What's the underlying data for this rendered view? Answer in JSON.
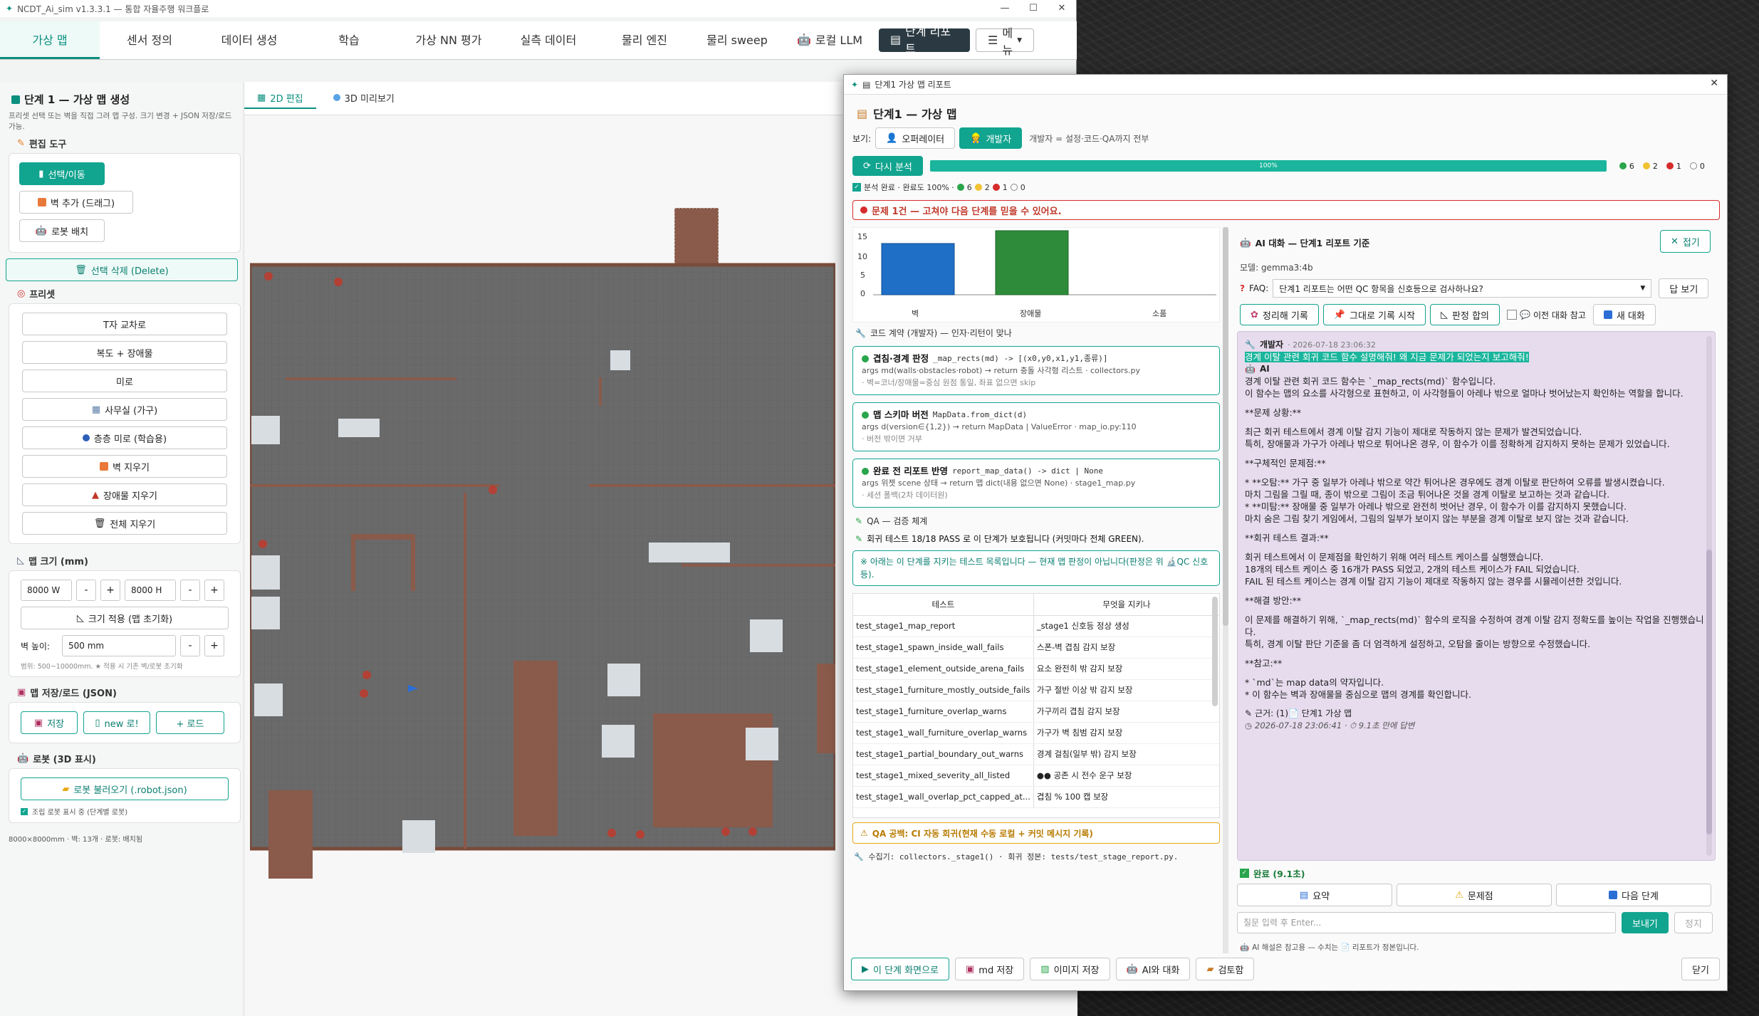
{
  "window": {
    "title": "NCDT_Ai_sim v1.3.3.1 — 통합 자율주행 워크플로"
  },
  "tabs": [
    {
      "label": "가상 맵"
    },
    {
      "label": "센서 정의"
    },
    {
      "label": "데이터 생성"
    },
    {
      "label": "학습"
    },
    {
      "label": "가상 NN 평가"
    },
    {
      "label": "실측 데이터"
    },
    {
      "label": "물리 엔진"
    },
    {
      "label": "물리 sweep"
    },
    {
      "label": "로컬 LLM"
    },
    {
      "label": "단계 리포트"
    },
    {
      "label": "메뉴"
    }
  ],
  "sidebar": {
    "title": "단계 1 — 가상 맵 생성",
    "desc": "프리셋 선택 또는 벽을 직접 그려 맵 구성. 크기 변경 + JSON 저장/로드 가능.",
    "edit_tools": "편집 도구",
    "select_move": "선택/이동",
    "add_wall": "벽 추가 (드래그)",
    "place_robot": "로봇 배치",
    "delete_sel": "선택 삭제 (Delete)",
    "presets_title": "프리셋",
    "presets": [
      "T자 교차로",
      "복도 + 장애물",
      "미로",
      "사무실 (가구)",
      "층층 미로 (학습용)",
      "벽 지우기",
      "장애물 지우기",
      "전체 지우기"
    ],
    "mapsize_title": "맵 크기 (mm)",
    "width": "8000 W",
    "height": "8000 H",
    "apply_size": "크기 적용 (맵 초기화)",
    "wall_height_label": "벽 높이:",
    "wall_height": "500 mm",
    "range_note": "범위: 500~10000mm. ★ 적용 시 기존 벽/로봇 초기화",
    "saveload_title": "맵 저장/로드 (JSON)",
    "save": "저장",
    "new": "new 로!",
    "load": "+ 로드",
    "robot_title": "로봇 (3D 표시)",
    "robot_load": "로봇 불러오기 (.robot.json)",
    "robot_check": "조립 로봇 표시 중 (단계별 로봇)",
    "status": "8000×8000mm · 벽: 13개 · 로봇: 배치됨"
  },
  "editor": {
    "tab2d": "2D 편집",
    "tab3d": "3D 미리보기"
  },
  "report": {
    "win_title": "단계1 가상 맵 리포트",
    "heading": "단계1 — 가상 맵",
    "view_label": "보기:",
    "operator": "오퍼레이터",
    "developer": "개발자",
    "dev_note": "개발자 = 설정·코드·QA까지 전부",
    "reanalyze": "다시 분석",
    "progress_label": "100%",
    "counts": {
      "green": "6",
      "yellow": "2",
      "red": "1",
      "none": "0"
    },
    "analysis_done": "분석 완료 · 완료도 100% ·",
    "issue_banner": "문제 1건 — 고쳐야 다음 단계를 믿을 수 있어요.",
    "contract_title": "코드 계약 (개발자) — 인자·리턴이 맞나",
    "contracts": [
      {
        "name": "겹침·경계 판정",
        "sig": "_map_rects(md) -> [(x0,y0,x1,y1,종류)]",
        "args": "args md(walls·obstacles·robot) → return 충돌 사각형 리스트 · collectors.py",
        "note": "· 벽=코너/장애물=중심 원점 통일, 좌표 없으면 skip"
      },
      {
        "name": "맵 스키마 버전",
        "sig": "MapData.from_dict(d)",
        "args": "args d(version∈{1,2}) → return MapData | ValueError · map_io.py:110",
        "note": "· 버전 밖이면 거부"
      },
      {
        "name": "완료 전 리포트 반영",
        "sig": "report_map_data() -> dict | None",
        "args": "args 위젯 scene 상태 → return 맵 dict(내용 없으면 None) · stage1_map.py",
        "note": "· 세션 폴백(2차 데이터원)"
      }
    ],
    "qa_title": "QA — 검증 체계",
    "qa_pass": "회귀 테스트 18/18 PASS 로 이 단계가 보호됩니다 (커밋마다 전체 GREEN).",
    "qa_note": "※ 아래는 이 단계를 지키는 테스트 목록입니다 — 현재 맵 판정이 아닙니다(판정은 위 🔬QC 신호등).",
    "qa_head": [
      "테스트",
      "무엇을 지키나"
    ],
    "qa_rows": [
      [
        "test_stage1_map_report",
        "_stage1 신호등 정상 생성"
      ],
      [
        "test_stage1_spawn_inside_wall_fails",
        "스폰-벽 겹침 감지 보장"
      ],
      [
        "test_stage1_element_outside_arena_fails",
        "요소 완전히 밖 감지 보장"
      ],
      [
        "test_stage1_furniture_mostly_outside_fails",
        "가구 절반 이상 밖 감지 보장"
      ],
      [
        "test_stage1_furniture_overlap_warns",
        "가구끼리 겹침 감지 보장"
      ],
      [
        "test_stage1_wall_furniture_overlap_warns",
        "가구가 벽 침범 감지 보장"
      ],
      [
        "test_stage1_partial_boundary_out_warns",
        "경계 걸침(일부 밖) 감지 보장"
      ],
      [
        "test_stage1_mixed_severity_all_listed",
        "●● 공존 시 전수 운구 보장"
      ],
      [
        "test_stage1_wall_overlap_pct_capped_at...",
        "겹침 % 100 캡 보장"
      ]
    ],
    "qa_gap": "QA 공백: CI 자동 회귀(현재 수동 로컬 + 커밋 메시지 기록)",
    "collector": "수집기: collectors._stage1() · 회귀 정본: tests/test_stage_report.py.",
    "chart": {
      "yticks": [
        "15",
        "10",
        "5",
        "0"
      ],
      "labels": [
        "벽",
        "장애물",
        "소품"
      ]
    },
    "ai_title": "AI 대화 — 단계1 리포트 기준",
    "collapse": "접기",
    "model": "모델: gemma3:4b",
    "faq_label": "FAQ:",
    "faq_value": "단계1 리포트는 어떤 QC 항목을 신호등으로 검사하나요?",
    "faq_btn": "답 보기",
    "chat_btns": [
      "정리해 기록",
      "그대로 기록 시작",
      "판정 합의"
    ],
    "prev_ref": "이전 대화 참고",
    "new_chat": "새 대화",
    "chat": {
      "user": "개발자",
      "time": "· 2026-07-18 23:06:32",
      "question": "경계 이탈 관련 회귀 코드 함수 설명해줘! 왜 지금 문제가 되었는지 보고해줘!",
      "ai": "AI",
      "lines": [
        "경계 이탈 관련 회귀 코드 함수는 `_map_rects(md)` 함수입니다.",
        "이 함수는 맵의 요소를 사각형으로 표현하고, 이 사각형들이 아레나 밖으로 얼마나 벗어났는지 확인하는 역할을 합니다.",
        "",
        "**문제 상황:**",
        "",
        "최근 회귀 테스트에서 경계 이탈 감지 기능이 제대로 작동하지 않는 문제가 발견되었습니다.",
        "특히, 장애물과 가구가 아레나 밖으로 튀어나온 경우, 이 함수가 이를 정확하게 감지하지 못하는 문제가 있었습니다.",
        "",
        "**구체적인 문제점:**",
        "",
        "* **오탐:** 가구 중 일부가 아레나 밖으로 약간 튀어나온 경우에도 경계 이탈로 판단하여 오류를 발생시켰습니다.",
        "마치 그림을 그릴 때, 종이 밖으로 그림이 조금 튀어나온 것을 경계 이탈로 보고하는 것과 같습니다.",
        "* **미탐:** 장애물 중 일부가 아레나 밖으로 완전히 벗어난 경우, 이 함수가 이를 감지하지 못했습니다.",
        "마치 숨은 그림 찾기 게임에서, 그림의 일부가 보이지 않는 부분을 경계 이탈로 보지 않는 것과 같습니다.",
        "",
        "**회귀 테스트 결과:**",
        "",
        "회귀 테스트에서 이 문제점을 확인하기 위해 여러 테스트 케이스를 실행했습니다.",
        "18개의 테스트 케이스 중 16개가 PASS 되었고, 2개의 테스트 케이스가 FAIL 되었습니다.",
        "FAIL 된 테스트 케이스는 경계 이탈 감지 기능이 제대로 작동하지 않는 경우를 시뮬레이션한 것입니다.",
        "",
        "**해결 방안:**",
        "",
        "이 문제를 해결하기 위해, `_map_rects(md)` 함수의 로직을 수정하여 경계 이탈 감지 정확도를 높이는 작업을 진행했습니다.",
        "특히, 경계 이탈 판단 기준을 좀 더 엄격하게 설정하고, 오탐을 줄이는 방향으로 수정했습니다.",
        "",
        "**참고:**",
        "",
        "* `md`는 map data의 약자입니다.",
        "* 이 함수는 벽과 장애물을 중심으로 맵의 경계를 확인합니다."
      ],
      "source": "근거: (1)📄 단계1 가상 맵",
      "stamp": "2026-07-18 23:06:41 · ⏱ 9.1초 만에 답변"
    },
    "done": "완료 (9.1초)",
    "sum_btns": [
      "요약",
      "문제점",
      "다음 단계"
    ],
    "input_placeholder": "질문 입력 후 Enter...",
    "send": "보내기",
    "stop": "정지",
    "footnote": "AI 해설은 참고용 — 수치는 📄 리포트가 정본입니다.",
    "bottom": [
      "이 단계 화면으로",
      "md 저장",
      "이미지 저장",
      "AI와 대화",
      "검토함"
    ],
    "close": "닫기"
  }
}
